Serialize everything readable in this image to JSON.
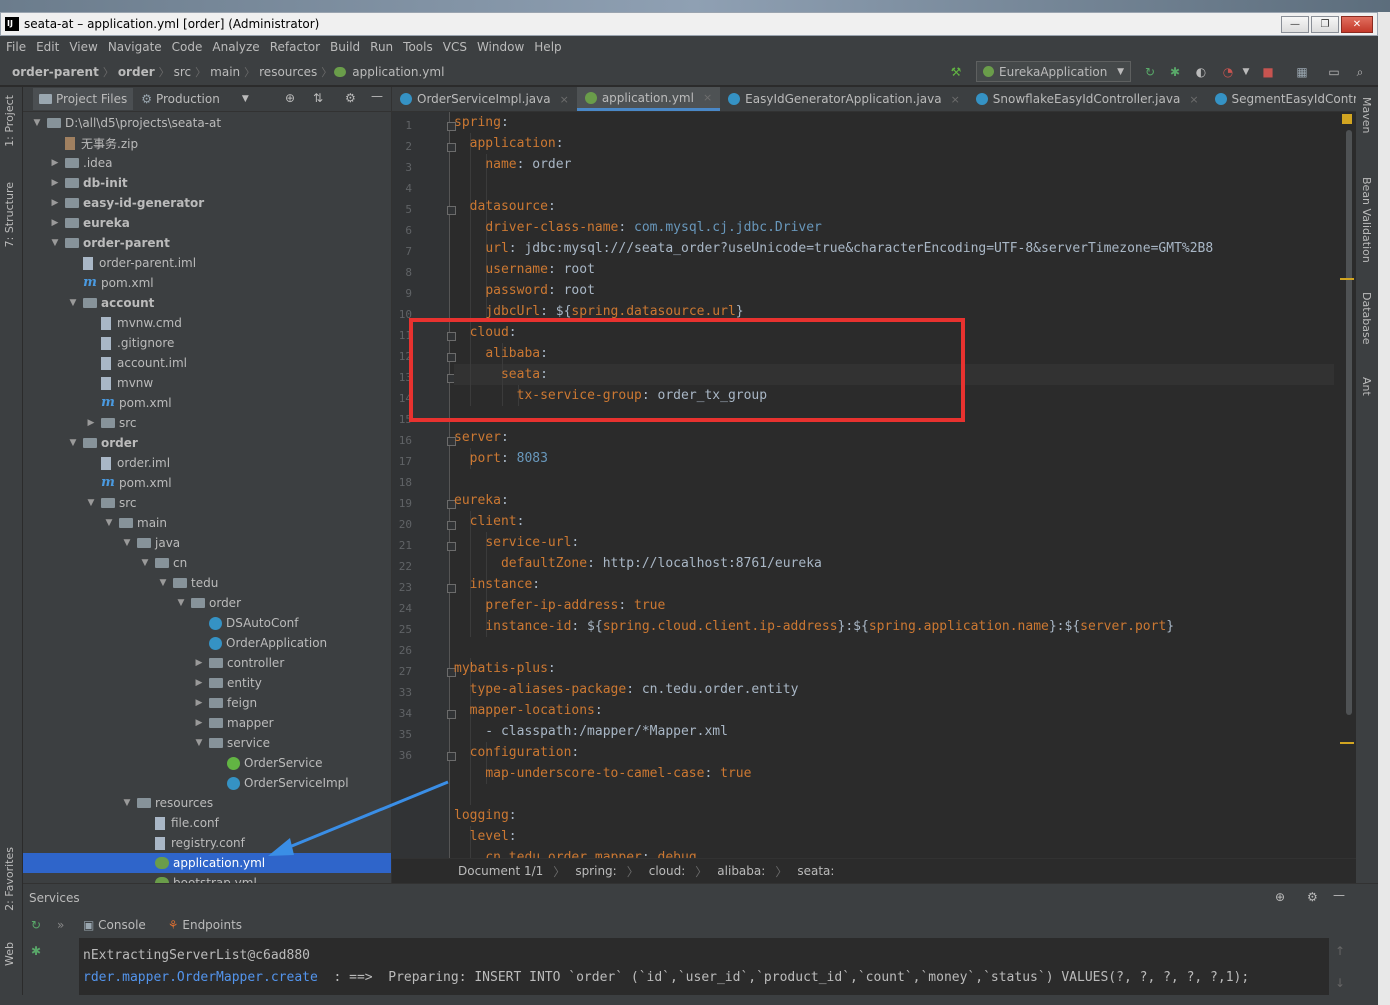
{
  "window": {
    "title": "seata-at – application.yml [order] (Administrator)",
    "btn_min": "—",
    "btn_max": "❐",
    "btn_close": "✕"
  },
  "menu": [
    "File",
    "Edit",
    "View",
    "Navigate",
    "Code",
    "Analyze",
    "Refactor",
    "Build",
    "Run",
    "Tools",
    "VCS",
    "Window",
    "Help"
  ],
  "breadcrumb": [
    "order-parent",
    "order",
    "src",
    "main",
    "resources",
    "application.yml"
  ],
  "run_config": "EurekaApplication",
  "left_tabs": {
    "project": "1: Project",
    "structure": "7: Structure",
    "favorites": "2: Favorites",
    "web": "Web"
  },
  "project_panel": {
    "tab_project": "Project Files",
    "tab_production": "Production"
  },
  "tree": [
    {
      "label": "D:\\all\\d5\\projects\\seata-at",
      "depth": 0,
      "arrow": "▼",
      "icon": "folder"
    },
    {
      "label": "无事务.zip",
      "depth": 1,
      "arrow": "",
      "icon": "zip"
    },
    {
      "label": ".idea",
      "depth": 1,
      "arrow": "▶",
      "icon": "folder"
    },
    {
      "label": "db-init",
      "depth": 1,
      "arrow": "▶",
      "icon": "folder",
      "bold": true
    },
    {
      "label": "easy-id-generator",
      "depth": 1,
      "arrow": "▶",
      "icon": "folder",
      "bold": true
    },
    {
      "label": "eureka",
      "depth": 1,
      "arrow": "▶",
      "icon": "folder",
      "bold": true
    },
    {
      "label": "order-parent",
      "depth": 1,
      "arrow": "▼",
      "icon": "folder",
      "bold": true
    },
    {
      "label": "order-parent.iml",
      "depth": 2,
      "arrow": "",
      "icon": "file"
    },
    {
      "label": "pom.xml",
      "depth": 2,
      "arrow": "",
      "icon": "m"
    },
    {
      "label": "account",
      "depth": 2,
      "arrow": "▼",
      "icon": "folder",
      "bold": true
    },
    {
      "label": "mvnw.cmd",
      "depth": 3,
      "arrow": "",
      "icon": "file"
    },
    {
      "label": ".gitignore",
      "depth": 3,
      "arrow": "",
      "icon": "file"
    },
    {
      "label": "account.iml",
      "depth": 3,
      "arrow": "",
      "icon": "file"
    },
    {
      "label": "mvnw",
      "depth": 3,
      "arrow": "",
      "icon": "file"
    },
    {
      "label": "pom.xml",
      "depth": 3,
      "arrow": "",
      "icon": "m"
    },
    {
      "label": "src",
      "depth": 3,
      "arrow": "▶",
      "icon": "folder"
    },
    {
      "label": "order",
      "depth": 2,
      "arrow": "▼",
      "icon": "folder",
      "bold": true
    },
    {
      "label": "order.iml",
      "depth": 3,
      "arrow": "",
      "icon": "file"
    },
    {
      "label": "pom.xml",
      "depth": 3,
      "arrow": "",
      "icon": "m"
    },
    {
      "label": "src",
      "depth": 3,
      "arrow": "▼",
      "icon": "folder"
    },
    {
      "label": "main",
      "depth": 4,
      "arrow": "▼",
      "icon": "folder"
    },
    {
      "label": "java",
      "depth": 5,
      "arrow": "▼",
      "icon": "folder"
    },
    {
      "label": "cn",
      "depth": 6,
      "arrow": "▼",
      "icon": "folder"
    },
    {
      "label": "tedu",
      "depth": 7,
      "arrow": "▼",
      "icon": "folder"
    },
    {
      "label": "order",
      "depth": 8,
      "arrow": "▼",
      "icon": "folder"
    },
    {
      "label": "DSAutoConf",
      "depth": 9,
      "arrow": "",
      "icon": "cls"
    },
    {
      "label": "OrderApplication",
      "depth": 9,
      "arrow": "",
      "icon": "cls"
    },
    {
      "label": "controller",
      "depth": 9,
      "arrow": "▶",
      "icon": "folder"
    },
    {
      "label": "entity",
      "depth": 9,
      "arrow": "▶",
      "icon": "folder"
    },
    {
      "label": "feign",
      "depth": 9,
      "arrow": "▶",
      "icon": "folder"
    },
    {
      "label": "mapper",
      "depth": 9,
      "arrow": "▶",
      "icon": "folder"
    },
    {
      "label": "service",
      "depth": 9,
      "arrow": "▼",
      "icon": "folder"
    },
    {
      "label": "OrderService",
      "depth": 10,
      "arrow": "",
      "icon": "intf"
    },
    {
      "label": "OrderServiceImpl",
      "depth": 10,
      "arrow": "",
      "icon": "cls"
    },
    {
      "label": "resources",
      "depth": 5,
      "arrow": "▼",
      "icon": "folder"
    },
    {
      "label": "file.conf",
      "depth": 6,
      "arrow": "",
      "icon": "file"
    },
    {
      "label": "registry.conf",
      "depth": 6,
      "arrow": "",
      "icon": "file"
    },
    {
      "label": "application.yml",
      "depth": 6,
      "arrow": "",
      "icon": "yml",
      "selected": true
    },
    {
      "label": "bootstrap.yml",
      "depth": 6,
      "arrow": "",
      "icon": "yml"
    }
  ],
  "editor_tabs": [
    {
      "label": "OrderServiceImpl.java",
      "icon": "cls"
    },
    {
      "label": "application.yml",
      "icon": "yml",
      "active": true
    },
    {
      "label": "EasyIdGeneratorApplication.java",
      "icon": "cls"
    },
    {
      "label": "SnowflakeEasyIdController.java",
      "icon": "cls"
    },
    {
      "label": "SegmentEasyIdContr",
      "icon": "cls"
    }
  ],
  "code_lines": [
    [
      [
        "k",
        "spring"
      ],
      [
        "v",
        ":"
      ]
    ],
    [
      [
        "v",
        "  "
      ],
      [
        "k",
        "application"
      ],
      [
        "v",
        ":"
      ]
    ],
    [
      [
        "v",
        "    "
      ],
      [
        "k",
        "name"
      ],
      [
        "v",
        ": order"
      ]
    ],
    [],
    [
      [
        "v",
        "  "
      ],
      [
        "k",
        "datasource"
      ],
      [
        "v",
        ":"
      ]
    ],
    [
      [
        "v",
        "    "
      ],
      [
        "k",
        "driver-class-name"
      ],
      [
        "v",
        ": "
      ],
      [
        "n",
        "com.mysql.cj.jdbc.Driver"
      ]
    ],
    [
      [
        "v",
        "    "
      ],
      [
        "k",
        "url"
      ],
      [
        "v",
        ": jdbc:mysql:///seata_order?useUnicode=true&characterEncoding=UTF-8&serverTimezone=GMT%2B8"
      ]
    ],
    [
      [
        "v",
        "    "
      ],
      [
        "k",
        "username"
      ],
      [
        "v",
        ": root"
      ]
    ],
    [
      [
        "v",
        "    "
      ],
      [
        "k",
        "password"
      ],
      [
        "v",
        ": root"
      ]
    ],
    [
      [
        "v",
        "    "
      ],
      [
        "k",
        "jdbcUrl"
      ],
      [
        "v",
        ": ${"
      ],
      [
        "k",
        "spring.datasource.url"
      ],
      [
        "v",
        "}"
      ]
    ],
    [
      [
        "v",
        "  "
      ],
      [
        "k",
        "cloud"
      ],
      [
        "v",
        ":"
      ]
    ],
    [
      [
        "v",
        "    "
      ],
      [
        "k",
        "alibaba"
      ],
      [
        "v",
        ":"
      ]
    ],
    [
      [
        "v",
        "      "
      ],
      [
        "k",
        "seata"
      ],
      [
        "v",
        ":"
      ]
    ],
    [
      [
        "v",
        "        "
      ],
      [
        "k",
        "tx-service-group"
      ],
      [
        "v",
        ": order_tx_group"
      ]
    ],
    [],
    [
      [
        "k",
        "server"
      ],
      [
        "v",
        ":"
      ]
    ],
    [
      [
        "v",
        "  "
      ],
      [
        "k",
        "port"
      ],
      [
        "v",
        ": "
      ],
      [
        "n",
        "8083"
      ]
    ],
    [],
    [
      [
        "k",
        "eureka"
      ],
      [
        "v",
        ":"
      ]
    ],
    [
      [
        "v",
        "  "
      ],
      [
        "k",
        "client"
      ],
      [
        "v",
        ":"
      ]
    ],
    [
      [
        "v",
        "    "
      ],
      [
        "k",
        "service-url"
      ],
      [
        "v",
        ":"
      ]
    ],
    [
      [
        "v",
        "      "
      ],
      [
        "k",
        "defaultZone"
      ],
      [
        "v",
        ": http://localhost:8761/eureka"
      ]
    ],
    [
      [
        "v",
        "  "
      ],
      [
        "k",
        "instance"
      ],
      [
        "v",
        ":"
      ]
    ],
    [
      [
        "v",
        "    "
      ],
      [
        "k",
        "prefer-ip-address"
      ],
      [
        "v",
        ": "
      ],
      [
        "k",
        "true"
      ]
    ],
    [
      [
        "v",
        "    "
      ],
      [
        "k",
        "instance-id"
      ],
      [
        "v",
        ": ${"
      ],
      [
        "k",
        "spring.cloud.client.ip-address"
      ],
      [
        "v",
        "}:${"
      ],
      [
        "k",
        "spring.application.name"
      ],
      [
        "v",
        "}:${"
      ],
      [
        "k",
        "server.port"
      ],
      [
        "v",
        "}"
      ]
    ],
    [],
    [
      [
        "k",
        "mybatis-plus"
      ],
      [
        "v",
        ":"
      ]
    ],
    [
      [
        "v",
        "  "
      ],
      [
        "k",
        "type-aliases-package"
      ],
      [
        "v",
        ": cn.tedu.order.entity"
      ]
    ],
    [
      [
        "v",
        "  "
      ],
      [
        "k",
        "mapper-locations"
      ],
      [
        "v",
        ":"
      ]
    ],
    [
      [
        "v",
        "    - classpath:/mapper/*Mapper.xml"
      ]
    ],
    [
      [
        "v",
        "  "
      ],
      [
        "k",
        "configuration"
      ],
      [
        "v",
        ":"
      ]
    ],
    [
      [
        "v",
        "    "
      ],
      [
        "k",
        "map-underscore-to-camel-case"
      ],
      [
        "v",
        ": "
      ],
      [
        "k",
        "true"
      ]
    ],
    [],
    [
      [
        "k",
        "logging"
      ],
      [
        "v",
        ":"
      ]
    ],
    [
      [
        "v",
        "  "
      ],
      [
        "k",
        "level"
      ],
      [
        "v",
        ":"
      ]
    ],
    [
      [
        "v",
        "    "
      ],
      [
        "k",
        "cn.tedu.order.mapper"
      ],
      [
        "v",
        ": "
      ],
      [
        "k",
        "debug"
      ]
    ]
  ],
  "line_numbers": [
    "1",
    "2",
    "3",
    "4",
    "5",
    "6",
    "7",
    "8",
    "9",
    "10",
    "11",
    "12",
    "13",
    "14",
    "15",
    "16",
    "17",
    "18",
    "19",
    "20",
    "21",
    "22",
    "23",
    "24",
    "25",
    "26",
    "27",
    "33",
    "34",
    "35",
    "36"
  ],
  "editor_breadcrumb": [
    "Document 1/1",
    "spring:",
    "cloud:",
    "alibaba:",
    "seata:"
  ],
  "right_tabs": [
    "Maven",
    "Bean Validation",
    "Database",
    "Ant"
  ],
  "services": {
    "title": "Services",
    "tab_console": "Console",
    "tab_endpoints": "Endpoints"
  },
  "console_lines": [
    "nExtractingServerList@c6ad880",
    "rder.mapper.OrderMapper.create  : ==>  Preparing: INSERT INTO `order` (`id`,`user_id`,`product_id`,`count`,`money`,`status`) VALUES(?, ?, ?, ?, ?,1);"
  ],
  "colors": {
    "highlight_box": "#e8322f",
    "arrow": "#3a8ee6",
    "selection": "#2f65ca",
    "keyword": "#cc7832"
  }
}
